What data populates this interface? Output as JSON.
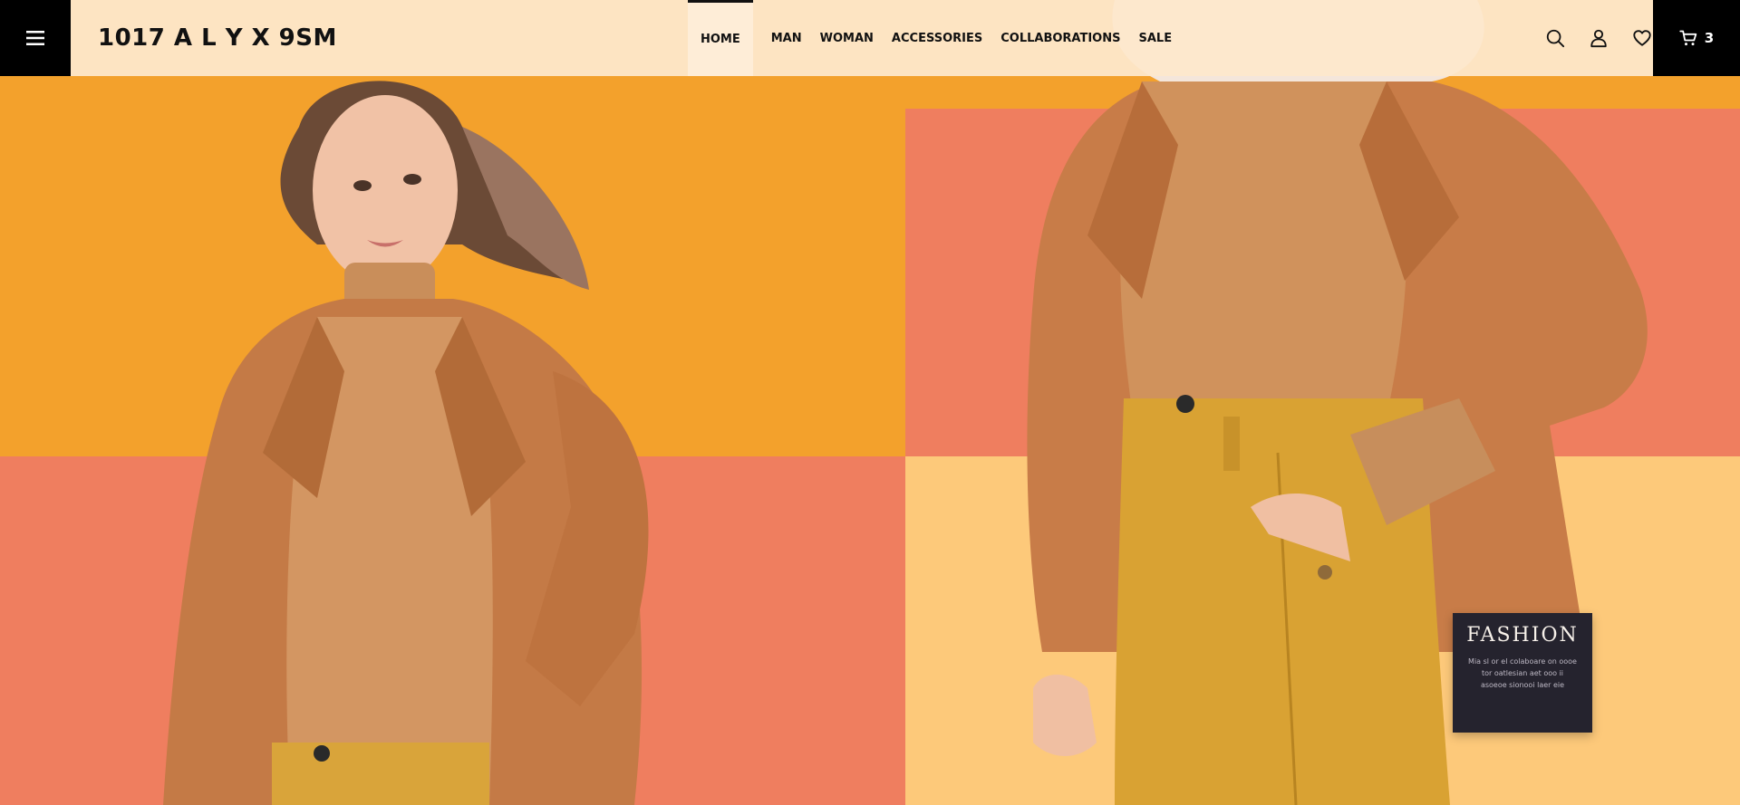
{
  "brand": {
    "name": "1017 A L Y X 9SM"
  },
  "nav": {
    "items": [
      {
        "label": "HOME",
        "active": true
      },
      {
        "label": "MAN"
      },
      {
        "label": "WOMAN"
      },
      {
        "label": "ACCESSORIES"
      },
      {
        "label": "COLLABORATIONS"
      },
      {
        "label": "SALE"
      }
    ]
  },
  "header_icons": [
    "menu-icon",
    "search-icon",
    "user-icon",
    "heart-icon",
    "cart-icon"
  ],
  "cart": {
    "count": "3"
  },
  "fashion_card": {
    "title": "FASHION",
    "text": "Mia sl or el colaboare on oooe tor oatlesian aet ooo ii asoeoe sionooi laer eie"
  },
  "colors": {
    "orange": "#f3a12c",
    "coral": "#ef7e5f",
    "pale_yellow": "#fdc97a",
    "header_bg": "#fde8cc",
    "black": "#000000",
    "card": "#25232e"
  }
}
